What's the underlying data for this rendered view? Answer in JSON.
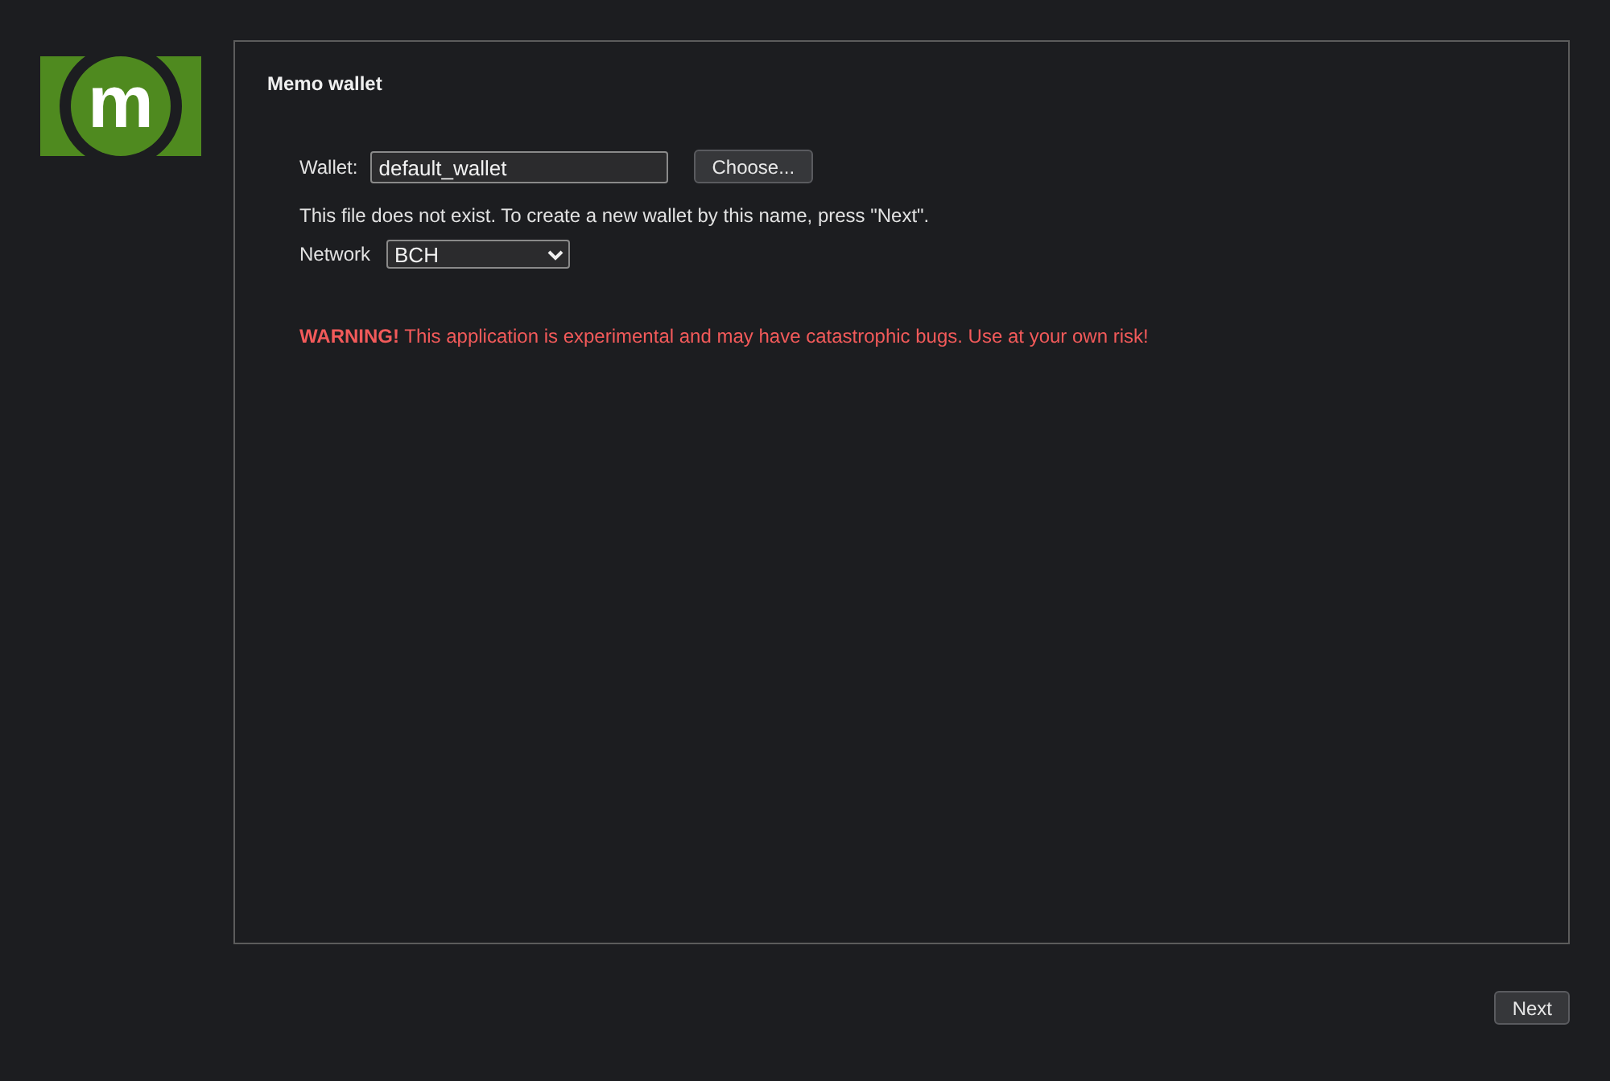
{
  "logo": {
    "letter": "m"
  },
  "panel": {
    "title": "Memo wallet",
    "wallet": {
      "label": "Wallet:",
      "value": "default_wallet",
      "button": "Choose..."
    },
    "notice": "This file does not exist. To create a new wallet by this name, press \"Next\".",
    "network": {
      "label": "Network",
      "value": "BCH"
    },
    "warning": "**WARNING!** This application is experimental and may have catastrophic bugs. Use at your own risk!"
  },
  "buttons": [
    {
      "label": "Next"
    }
  ]
}
